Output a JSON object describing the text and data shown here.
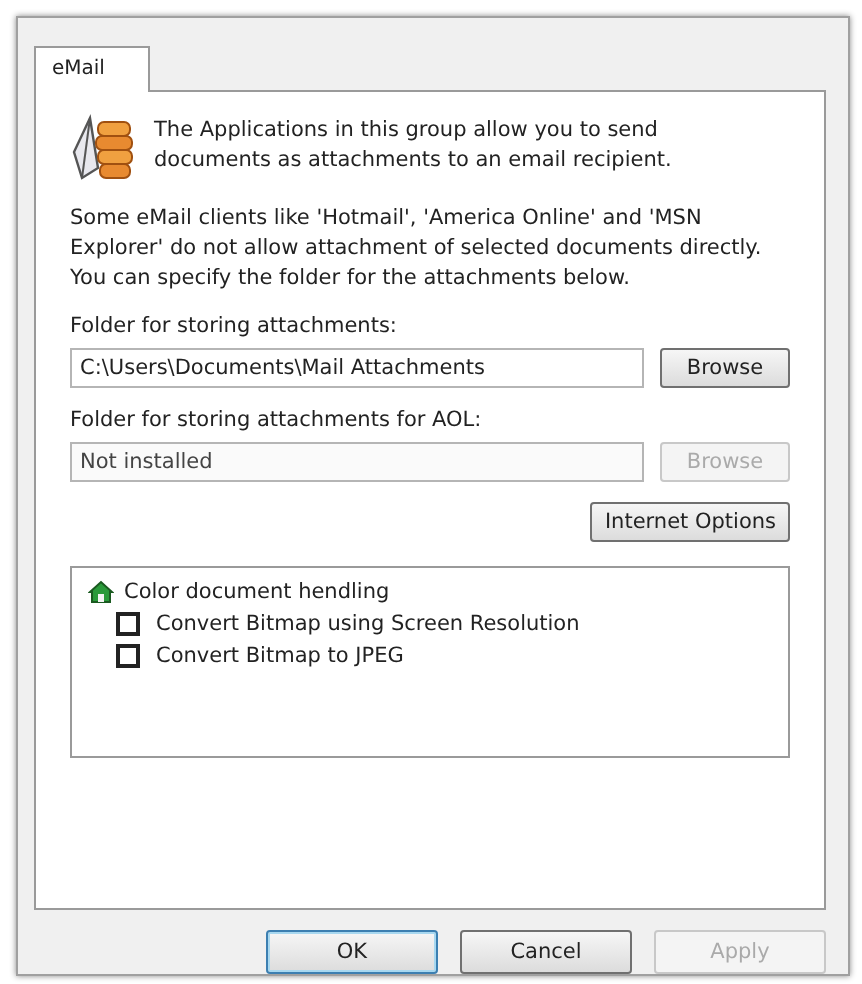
{
  "tabs": [
    {
      "label": "eMail",
      "selected": true
    }
  ],
  "intro": "The Applications in this group allow you to send documents as attachments to an email recipient.",
  "note": "Some eMail clients like 'Hotmail', 'America Online' and 'MSN Explorer' do not allow attachment of selected documents directly. You can specify the folder for the attachments below.",
  "folders": [
    {
      "label": "Folder for storing attachments:",
      "value": "C:\\Users\\Documents\\Mail Attachments",
      "disabled": false,
      "button": "Browse"
    },
    {
      "label": "Folder for storing attachments for AOL:",
      "value": "Not installed",
      "disabled": true,
      "button": "Browse"
    }
  ],
  "internet_options": "Internet Options",
  "tree": {
    "label": "Color document hendling",
    "children": [
      {
        "label": "Convert Bitmap using Screen Resolution",
        "checked": false
      },
      {
        "label": "Convert Bitmap to JPEG",
        "checked": false
      }
    ]
  },
  "buttons": [
    {
      "label": "OK",
      "disabled": false,
      "default": true
    },
    {
      "label": "Cancel",
      "disabled": false,
      "default": false
    },
    {
      "label": "Apply",
      "disabled": true,
      "default": false
    }
  ]
}
